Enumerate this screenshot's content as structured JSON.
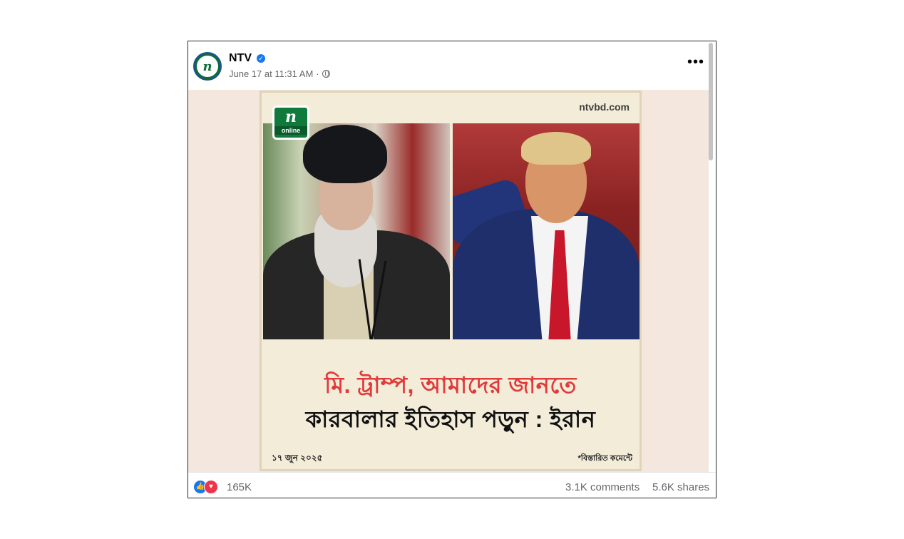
{
  "post": {
    "page_name": "NTV",
    "timestamp": "June 17 at 11:31 AM",
    "separator": "·",
    "privacy_icon": "globe-icon",
    "more_icon": "more-dots-icon"
  },
  "image": {
    "site": "ntvbd.com",
    "logo_mark": "n",
    "logo_text": "online",
    "headline_line1": "মি. ট্রাম্প, আমাদের জানতে",
    "headline_line2": "কারবালার ইতিহাস পড়ুন : ইরান",
    "date": "১৭ জুন ২০২৫",
    "detail_note": "*বিস্তারিত কমেন্টে",
    "headline_color": "#e23a3a"
  },
  "footer": {
    "reactions_count": "165K",
    "comments": "3.1K comments",
    "shares": "5.6K shares",
    "like_color": "#1877f2",
    "love_color": "#f0334b"
  }
}
